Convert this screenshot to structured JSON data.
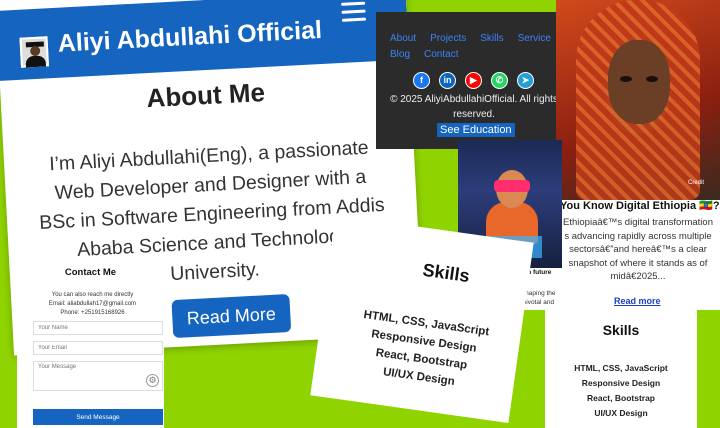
{
  "about": {
    "brand": "Aliyi Abdullahi Official",
    "heading": "About Me",
    "text": "I’m Aliyi Abdullahi(Eng), a passionate Web Developer and Designer with a BSc in Software Engineering from Addis Ababa Science and Technology University.",
    "button": "Read More"
  },
  "footer": {
    "nav": [
      "About",
      "Projects",
      "Skills",
      "Service",
      "Blog",
      "Contact"
    ],
    "socials": [
      {
        "icon": "facebook-icon",
        "glyph": "f",
        "color": "#1877f2"
      },
      {
        "icon": "linkedin-icon",
        "glyph": "in",
        "color": "#0a66c2"
      },
      {
        "icon": "youtube-icon",
        "glyph": "▶",
        "color": "#ff0000"
      },
      {
        "icon": "whatsapp-icon",
        "glyph": "✆",
        "color": "#25d366"
      },
      {
        "icon": "telegram-icon",
        "glyph": "➤",
        "color": "#229ed9"
      }
    ],
    "copyright": "© 2025 AliyiAbdullahiOfficial. All rights reserved.",
    "button": "See Education"
  },
  "blog_ethiopia": {
    "credit": "Credit",
    "title": "You Know Digital Ethiopia 🇪🇹?",
    "text": "Ethiopiaâ€™s digital transformation s advancing rapidly across multiple sectorsâ€”and hereâ€™s a clear snapshot of where it stands as of midâ€2025...",
    "link": "Read more"
  },
  "blog_youth": {
    "title": "The Role of Youth in future world!",
    "text": "The role of youth in shaping the future world is both pivotal and"
  },
  "contact": {
    "heading": "Contact Me",
    "line1": "You can also reach me directly",
    "email": "Email: aliabdullah17@gmail.com",
    "phone": "Phone: +251915168926",
    "name_placeholder": "Your Name",
    "email_placeholder": "Your Email",
    "message_placeholder": "Your Message",
    "send": "Send Message"
  },
  "skills": {
    "heading": "Skills",
    "items": [
      "HTML, CSS, JavaScript",
      "Responsive Design",
      "React, Bootstrap",
      "UI/UX Design"
    ]
  }
}
